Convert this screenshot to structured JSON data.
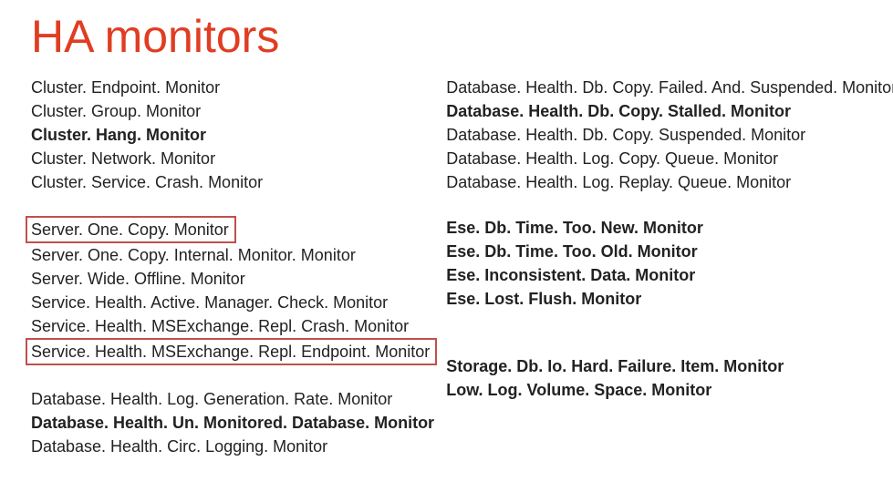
{
  "title": "HA monitors",
  "left": {
    "cluster": [
      "Cluster. Endpoint. Monitor",
      "Cluster. Group. Monitor",
      "Cluster. Hang. Monitor",
      "Cluster. Network. Monitor",
      "Cluster. Service. Crash. Monitor"
    ],
    "server": [
      "Server. One. Copy. Monitor",
      "Server. One. Copy. Internal. Monitor. Monitor",
      "Server. Wide. Offline. Monitor",
      "Service. Health. Active. Manager. Check. Monitor",
      "Service. Health. MSExchange. Repl. Crash. Monitor",
      "Service. Health. MSExchange. Repl. Endpoint. Monitor"
    ],
    "dbhealth": [
      "Database. Health. Log. Generation. Rate. Monitor",
      "Database. Health. Un. Monitored. Database. Monitor",
      "Database. Health. Circ. Logging. Monitor"
    ]
  },
  "right": {
    "dbhealth": [
      "Database. Health. Db. Copy. Failed. And. Suspended. Monitor",
      "Database. Health. Db. Copy. Stalled. Monitor",
      "Database. Health. Db. Copy. Suspended. Monitor",
      "Database. Health. Log. Copy. Queue. Monitor",
      "Database. Health. Log. Replay. Queue. Monitor"
    ],
    "ese": [
      "Ese. Db. Time. Too. New. Monitor",
      "Ese. Db. Time. Too. Old. Monitor",
      "Ese. Inconsistent. Data. Monitor",
      "Ese. Lost. Flush. Monitor"
    ],
    "storage": [
      "Storage. Db. Io. Hard. Failure. Item. Monitor",
      "Low. Log. Volume. Space. Monitor"
    ]
  }
}
